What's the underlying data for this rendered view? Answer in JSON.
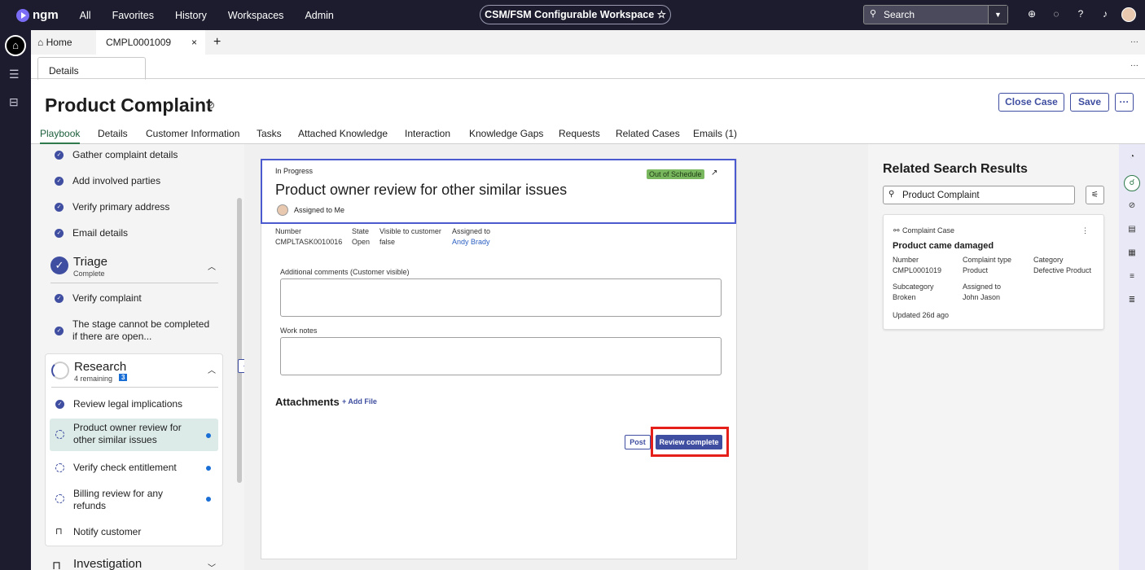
{
  "top": {
    "brand": "ngm",
    "nav": [
      "All",
      "Favorites",
      "History",
      "Workspaces",
      "Admin"
    ],
    "workspace": "CSM/FSM Configurable Workspace",
    "search_label": "Search"
  },
  "tabs": {
    "home": "Home",
    "record": "CMPL0001009",
    "close": "×",
    "add": "+",
    "more": "···"
  },
  "subtab": {
    "label": "Details"
  },
  "page": {
    "title": "Product Complaint",
    "close_case": "Close Case",
    "save": "Save",
    "more": "···"
  },
  "menu": [
    "Playbook",
    "Details",
    "Customer Information",
    "Tasks",
    "Attached Knowledge",
    "Interaction",
    "Knowledge Gaps",
    "Requests",
    "Related Cases",
    "Emails (1)"
  ],
  "playbook": {
    "top_items": [
      "Gather complaint details",
      "Add involved parties",
      "Verify primary address",
      "Email details"
    ],
    "triage": {
      "title": "Triage",
      "status": "Complete",
      "items": [
        "Verify complaint",
        "The stage cannot be completed if there are open..."
      ]
    },
    "research": {
      "title": "Research",
      "status": "4 remaining",
      "count": "3",
      "items": [
        "Review legal implications",
        "Product owner review for other similar issues",
        "Verify check entitlement",
        "Billing review for any refunds",
        "Notify customer"
      ]
    },
    "investigation": {
      "title": "Investigation"
    }
  },
  "task": {
    "state_label": "In Progress",
    "schedule": "Out of Schedule",
    "title": "Product owner review for other similar issues",
    "assigned": "Assigned to Me",
    "fields": [
      {
        "label": "Number",
        "value": "CMPLTASK0010016"
      },
      {
        "label": "State",
        "value": "Open"
      },
      {
        "label": "Visible to customer",
        "value": "false"
      },
      {
        "label": "Assigned to",
        "value": "Andy Brady"
      }
    ],
    "comments_label": "Additional comments (Customer visible)",
    "worknotes_label": "Work notes",
    "attachments": "Attachments",
    "add_file": "+ Add File",
    "post": "Post",
    "review": "Review complete"
  },
  "related": {
    "title": "Related Search Results",
    "query": "Product Complaint",
    "card": {
      "type": "Complaint Case",
      "title": "Product came damaged",
      "fields": [
        {
          "label": "Number",
          "value": "CMPL0001019"
        },
        {
          "label": "Complaint type",
          "value": "Product"
        },
        {
          "label": "Category",
          "value": "Defective Product"
        },
        {
          "label": "Subcategory",
          "value": "Broken"
        },
        {
          "label": "Assigned to",
          "value": "John Jason"
        }
      ],
      "updated": "Updated 26d ago"
    }
  },
  "colors": {
    "accent": "#3f4ea0",
    "highlight": "#e5201b",
    "topbar": "#1c1c2e",
    "schedule_badge": "#7ab85f"
  }
}
